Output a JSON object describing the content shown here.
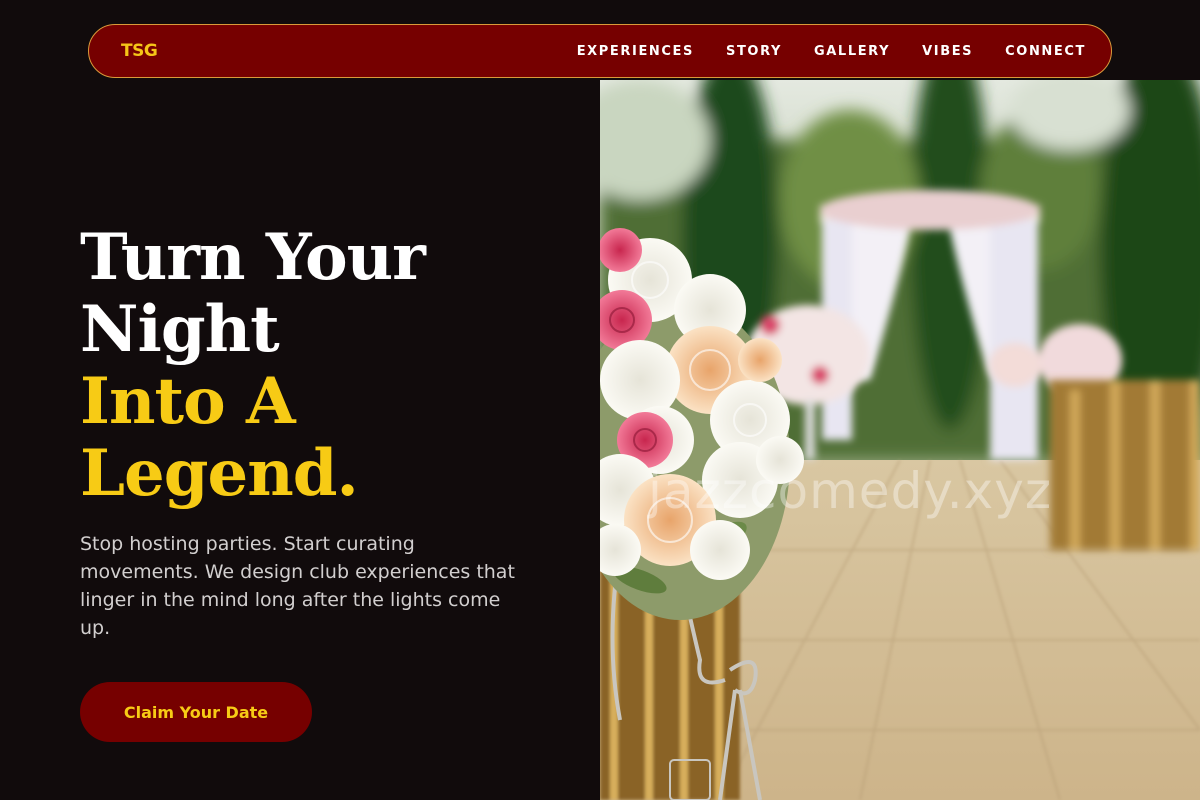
{
  "nav": {
    "logo": "TSG",
    "links": [
      "EXPERIENCES",
      "STORY",
      "GALLERY",
      "VIBES",
      "CONNECT"
    ]
  },
  "hero": {
    "headline_line1": "Turn Your",
    "headline_line2": "Night",
    "headline_line3": "Into A",
    "headline_line4": "Legend.",
    "subtext": "Stop hosting parties. Start curating movements. We design club experiences that linger in the mind long after the lights come up.",
    "cta_label": "Claim Your Date"
  },
  "photo": {
    "watermark": "jazzcomedy.xyz"
  },
  "colors": {
    "background": "#110b0c",
    "brand_red": "#760000",
    "accent_gold": "#f7cb15",
    "nav_border": "#d99a3a"
  }
}
